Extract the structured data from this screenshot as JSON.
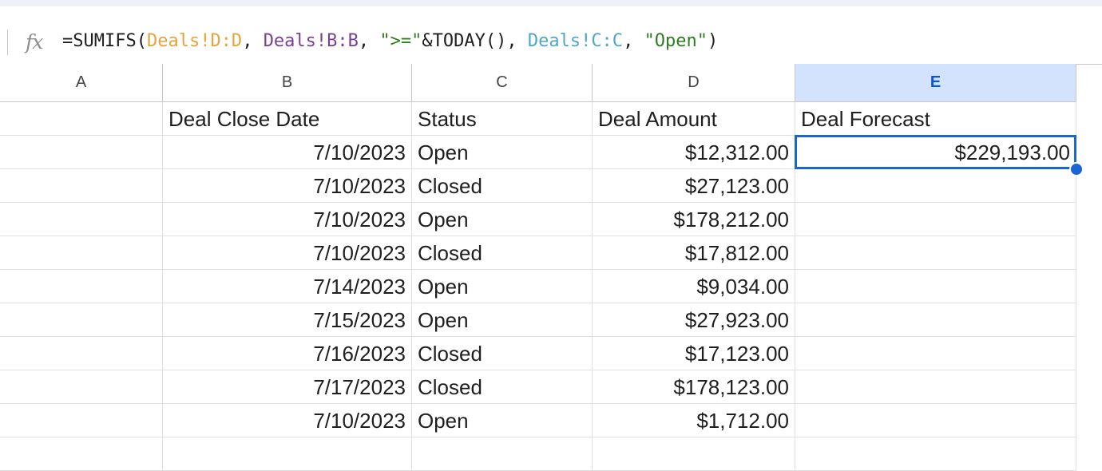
{
  "formula_bar": {
    "icon": "fx-icon",
    "tokens": [
      {
        "text": "=SUMIFS(",
        "color": "#1f1f1f"
      },
      {
        "text": "Deals!D:D",
        "color": "#e8a33d"
      },
      {
        "text": ", ",
        "color": "#1f1f1f"
      },
      {
        "text": "Deals!B:B",
        "color": "#7b3f95"
      },
      {
        "text": ", ",
        "color": "#1f1f1f"
      },
      {
        "text": "\">=\"",
        "color": "#2f7d1f"
      },
      {
        "text": "&TODAY(), ",
        "color": "#1f1f1f"
      },
      {
        "text": "Deals!C:C",
        "color": "#4fa7c7"
      },
      {
        "text": ", ",
        "color": "#1f1f1f"
      },
      {
        "text": "\"Open\"",
        "color": "#2f7d1f"
      },
      {
        "text": ")",
        "color": "#1f1f1f"
      }
    ]
  },
  "columns": [
    "A",
    "B",
    "C",
    "D",
    "E"
  ],
  "selected_column": "E",
  "header_row": {
    "a": "",
    "b": "Deal Close Date",
    "c": "Status",
    "d": "Deal Amount",
    "e": "Deal Forecast"
  },
  "rows": [
    {
      "a": "",
      "b": "7/10/2023",
      "c": "Open",
      "d": "$12,312.00",
      "e": "$229,193.00"
    },
    {
      "a": "",
      "b": "7/10/2023",
      "c": "Closed",
      "d": "$27,123.00",
      "e": ""
    },
    {
      "a": "",
      "b": "7/10/2023",
      "c": "Open",
      "d": "$178,212.00",
      "e": ""
    },
    {
      "a": "",
      "b": "7/10/2023",
      "c": "Closed",
      "d": "$17,812.00",
      "e": ""
    },
    {
      "a": "",
      "b": "7/14/2023",
      "c": "Open",
      "d": "$9,034.00",
      "e": ""
    },
    {
      "a": "",
      "b": "7/15/2023",
      "c": "Open",
      "d": "$27,923.00",
      "e": ""
    },
    {
      "a": "",
      "b": "7/16/2023",
      "c": "Closed",
      "d": "$17,123.00",
      "e": ""
    },
    {
      "a": "",
      "b": "7/17/2023",
      "c": "Closed",
      "d": "$178,123.00",
      "e": ""
    },
    {
      "a": "",
      "b": "7/10/2023",
      "c": "Open",
      "d": "$1,712.00",
      "e": ""
    },
    {
      "a": "",
      "b": "",
      "c": "",
      "d": "",
      "e": ""
    }
  ],
  "active_cell": {
    "column": "E",
    "row_index": 0
  },
  "accent_color": "#1a64d6"
}
